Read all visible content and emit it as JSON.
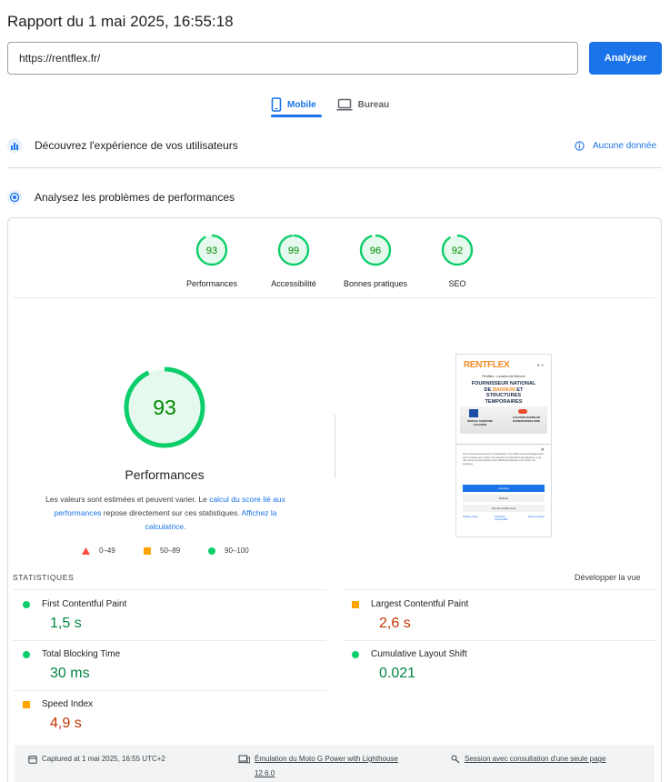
{
  "report": {
    "title": "Rapport du 1 mai 2025, 16:55:18"
  },
  "url_bar": {
    "value": "https://rentflex.fr/",
    "analyze_label": "Analyser"
  },
  "tabs": [
    {
      "label": "Mobile",
      "icon": "smartphone-icon",
      "active": true
    },
    {
      "label": "Bureau",
      "icon": "laptop-icon",
      "active": false
    }
  ],
  "field_data": {
    "title": "Découvrez l'expérience de vos utilisateurs",
    "status": "Aucune donnée"
  },
  "lab_data": {
    "title": "Analysez les problèmes de performances"
  },
  "scores": [
    {
      "label": "Performances",
      "value": "93"
    },
    {
      "label": "Accessibilité",
      "value": "99"
    },
    {
      "label": "Bonnes pratiques",
      "value": "96"
    },
    {
      "label": "SEO",
      "value": "92"
    }
  ],
  "performance": {
    "score": "93",
    "score_fraction": 0.93,
    "title": "Performances",
    "note_1": "Les valeurs sont estimées et peuvent varier. Le ",
    "note_link_1": "calcul du score lié aux performances",
    "note_2": " repose directement sur ces statistiques. ",
    "note_link_2": "Affichez la calculatrice",
    "note_3": "."
  },
  "legend": [
    {
      "range": "0–49",
      "color": "#ff4e42"
    },
    {
      "range": "50–89",
      "color": "#ffa400"
    },
    {
      "range": "90–100",
      "color": "#0cce6b"
    }
  ],
  "screenshot": {
    "brand": "RENTFLEX",
    "subtitle": "Rentflex - Location de Barnum",
    "headline_1": "FOURNISSEUR NATIONAL",
    "headline_2_a": "DE ",
    "headline_2_b": "BARNUM",
    "headline_2_c": " ET",
    "headline_3": "STRUCTURES",
    "headline_4": "TEMPORAIRES",
    "card_1": "MODULE SANITAIRE LOCATION",
    "card_2": "LOCATION RAPIDE DE BARNUM MODULAIRE",
    "cookie_text": "Avec vos consentement avec nos partenaires, nous utilisons des technologies telles que les cookies pour stocker et/ou accéder aux informations des appareils, ce qui nous permet de vous proposer des publicités pertinentes et de mesurer nos audiences.",
    "accept": "Accepter",
    "refuse": "Refuser",
    "prefs": "Voir les préférences",
    "link_1": "Politique cookie",
    "link_2": "Déclaration confidentialité",
    "link_3": "Mentions légales"
  },
  "stats": {
    "heading": "STATISTIQUES",
    "expand": "Développer la vue",
    "metrics": [
      {
        "name": "First Contentful Paint",
        "value": "1,5 s",
        "rating": "good"
      },
      {
        "name": "Largest Contentful Paint",
        "value": "2,6 s",
        "rating": "average"
      },
      {
        "name": "Total Blocking Time",
        "value": "30 ms",
        "rating": "good"
      },
      {
        "name": "Cumulative Layout Shift",
        "value": "0.021",
        "rating": "good"
      },
      {
        "name": "Speed Index",
        "value": "4,9 s",
        "rating": "average"
      }
    ]
  },
  "footer": {
    "captured": "Captured at 1 mai 2025, 16:55 UTC+2",
    "emulation": "Émulation du Moto G Power with Lighthouse",
    "emulation_version": "12.6.0",
    "session": "Session avec consultation d'une seule page"
  }
}
